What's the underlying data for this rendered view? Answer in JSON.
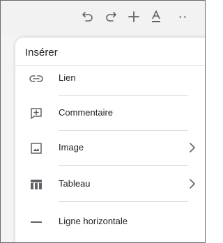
{
  "toolbar": {
    "icons": [
      "undo-icon",
      "redo-icon",
      "add-icon",
      "text-color-icon",
      "more-icon"
    ],
    "more_label": "··"
  },
  "menu": {
    "title": "Insérer",
    "items": [
      {
        "label": "Lien",
        "icon": "link-icon",
        "has_submenu": false
      },
      {
        "label": "Commentaire",
        "icon": "comment-icon",
        "has_submenu": false
      },
      {
        "label": "Image",
        "icon": "image-icon",
        "has_submenu": true
      },
      {
        "label": "Tableau",
        "icon": "table-icon",
        "has_submenu": true
      },
      {
        "label": "Ligne horizontale",
        "icon": "horizontal-line-icon",
        "has_submenu": false
      }
    ]
  },
  "colors": {
    "icon": "#5f6368",
    "text": "#202124",
    "divider": "#dadce0",
    "toolbar_bg": "#f2f2f2"
  }
}
